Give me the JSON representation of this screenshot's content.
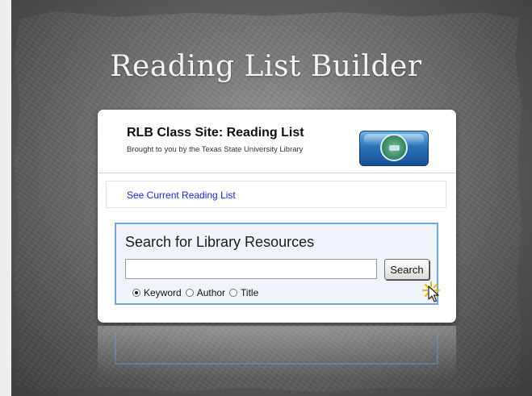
{
  "slide": {
    "title": "Reading List Builder"
  },
  "header": {
    "site_title": "RLB Class Site: Reading List",
    "subtitle": "Brought to you by the Texas State University Library"
  },
  "current_list": {
    "link_label": "See Current Reading List"
  },
  "search": {
    "heading": "Search for Library Resources",
    "input_value": "",
    "button_label": "Search",
    "options": [
      {
        "label": "Keyword",
        "checked": true
      },
      {
        "label": "Author",
        "checked": false
      },
      {
        "label": "Title",
        "checked": false
      }
    ]
  },
  "colors": {
    "link": "#1a26c7",
    "search_border": "#6fa6d3",
    "search_bg": "#eef4fa"
  },
  "icons": [
    "library-logo-icon",
    "mouse-pointer-icon",
    "click-burst-icon"
  ]
}
